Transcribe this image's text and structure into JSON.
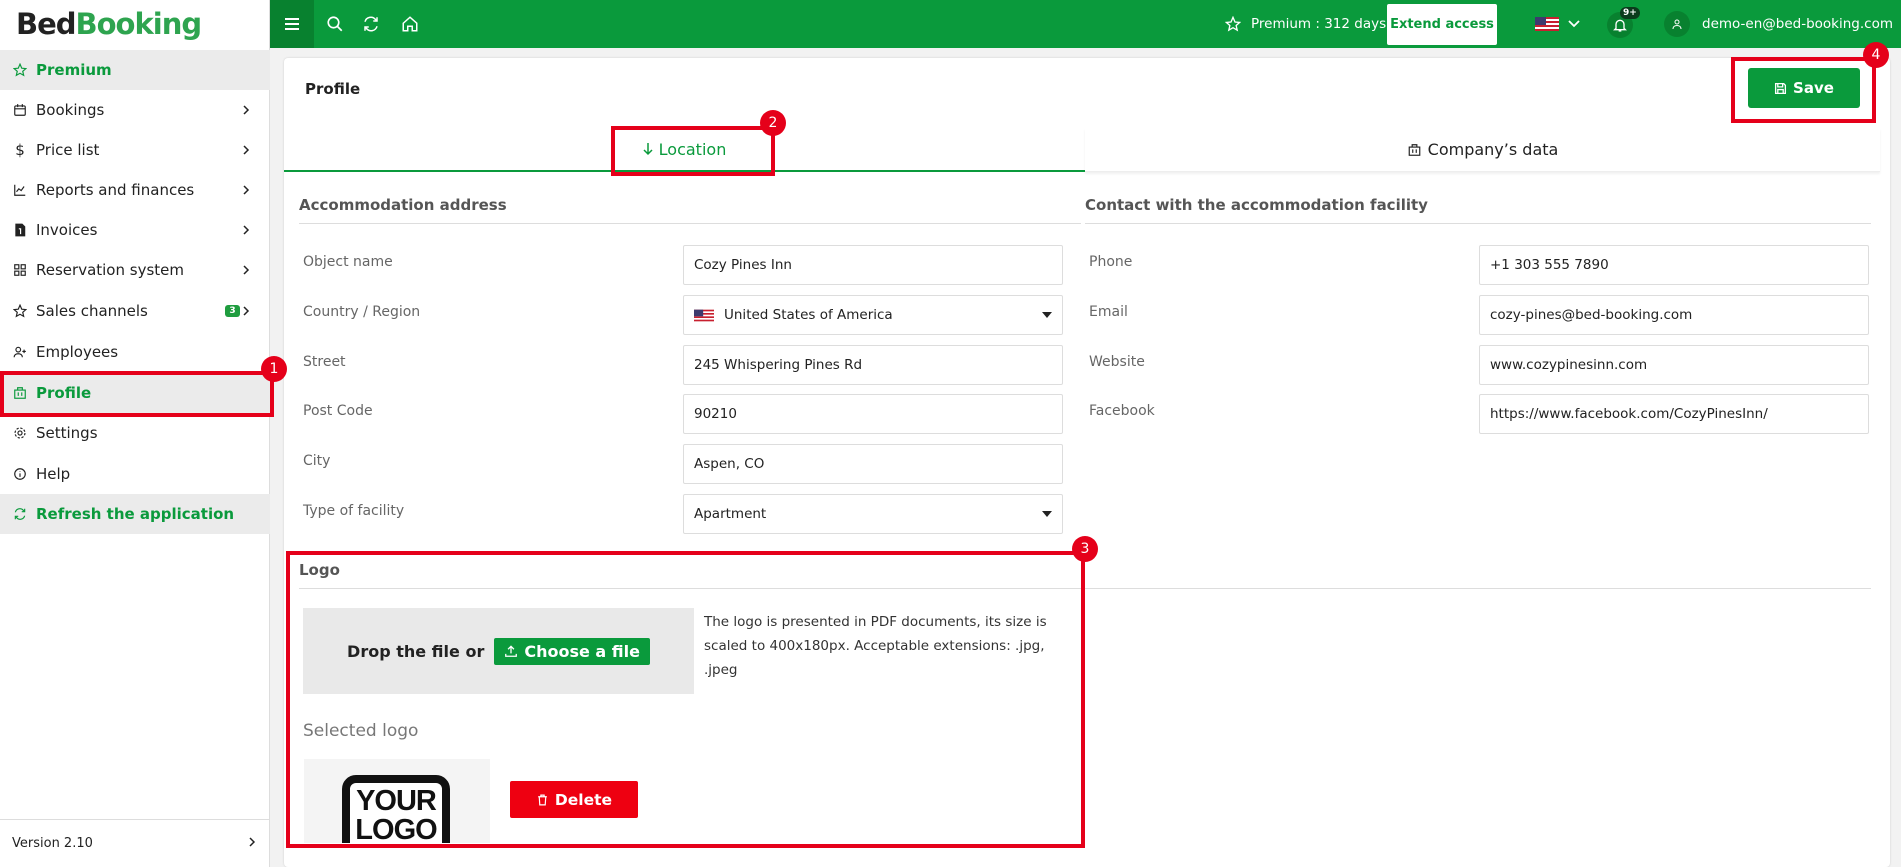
{
  "brand": {
    "part1": "Bed",
    "part2": "Booking"
  },
  "sidebar": {
    "items": [
      {
        "label": "Premium",
        "icon": "star-icon"
      },
      {
        "label": "Bookings",
        "icon": "calendar-icon"
      },
      {
        "label": "Price list",
        "icon": "dollar-icon"
      },
      {
        "label": "Reports and finances",
        "icon": "chart-icon"
      },
      {
        "label": "Invoices",
        "icon": "invoice-icon"
      },
      {
        "label": "Reservation system",
        "icon": "grid-icon"
      },
      {
        "label": "Sales channels",
        "icon": "star-outline-icon",
        "badge": "3"
      },
      {
        "label": "Employees",
        "icon": "user-add-icon"
      },
      {
        "label": "Profile",
        "icon": "building-icon"
      },
      {
        "label": "Settings",
        "icon": "gear-icon"
      },
      {
        "label": "Help",
        "icon": "info-icon"
      },
      {
        "label": "Refresh the application",
        "icon": "refresh-icon"
      }
    ],
    "version": "Version 2.10"
  },
  "topbar": {
    "premium": "Premium : 312 days",
    "extend": "Extend access",
    "notifications_badge": "9+",
    "user_email": "demo-en@bed-booking.com"
  },
  "profile": {
    "title": "Profile",
    "save": "Save",
    "tabs": [
      "Location",
      "Company’s data"
    ],
    "address": {
      "heading": "Accommodation address",
      "fields": [
        {
          "label": "Object name",
          "value": "Cozy Pines Inn"
        },
        {
          "label": "Country / Region",
          "value": "United States of America"
        },
        {
          "label": "Street",
          "value": "245 Whispering Pines Rd"
        },
        {
          "label": "Post Code",
          "value": "90210"
        },
        {
          "label": "City",
          "value": "Aspen, CO"
        },
        {
          "label": "Type of facility",
          "value": "Apartment"
        }
      ]
    },
    "contact": {
      "heading": "Contact with the accommodation facility",
      "fields": [
        {
          "label": "Phone",
          "value": "+1 303 555 7890"
        },
        {
          "label": "Email",
          "value": "cozy-pines@bed-booking.com"
        },
        {
          "label": "Website",
          "value": "www.cozypinesinn.com"
        },
        {
          "label": "Facebook",
          "value": "https://www.facebook.com/CozyPinesInn/"
        }
      ]
    },
    "logo": {
      "heading": "Logo",
      "drop_text": "Drop the file or",
      "choose": "Choose a file",
      "note": "The logo is presented in PDF documents, its size is scaled to 400x180px. Acceptable extensions: .jpg, .jpeg",
      "selected": "Selected logo",
      "image_text": "YOUR LOGO",
      "delete": "Delete"
    }
  },
  "annotations": [
    "1",
    "2",
    "3",
    "4"
  ],
  "colors": {
    "brand_green": "#0a9a3c",
    "annotation_red": "#e5001a",
    "delete_red": "#ee0011"
  }
}
